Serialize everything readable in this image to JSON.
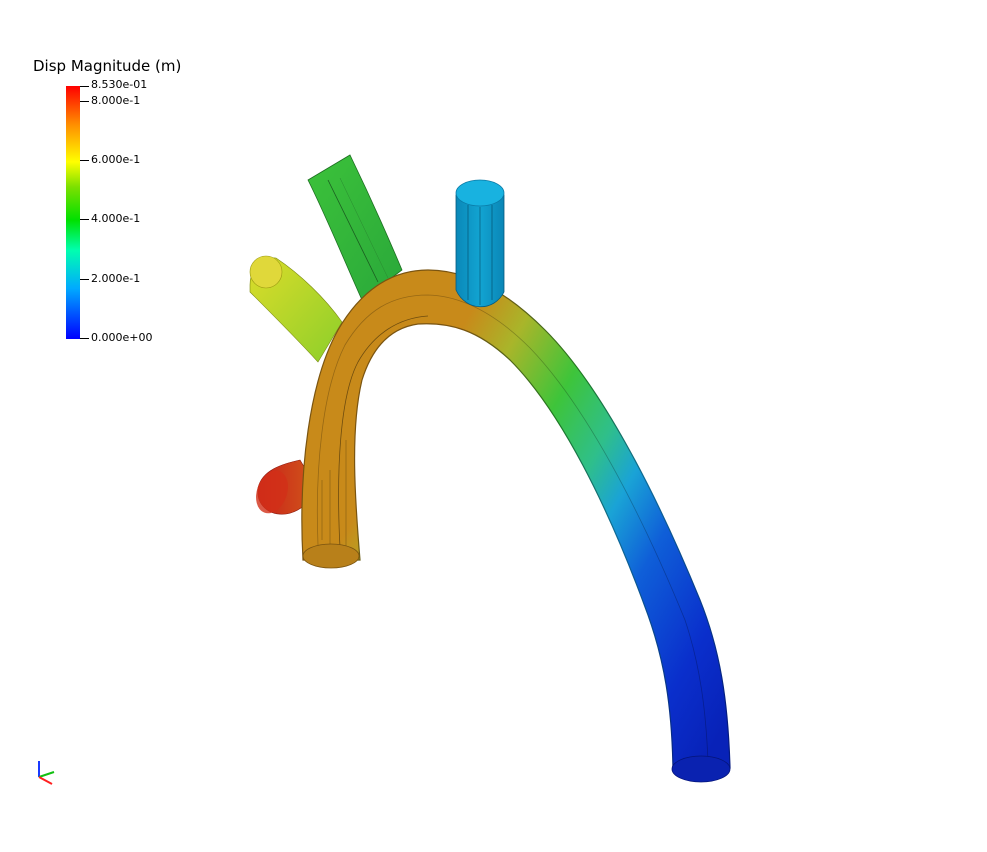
{
  "legend": {
    "title": "Disp Magnitude (m)",
    "ticks": [
      {
        "label": "8.530e-01",
        "value": 0.853
      },
      {
        "label": "8.000e-1",
        "value": 0.8
      },
      {
        "label": "6.000e-1",
        "value": 0.6
      },
      {
        "label": "4.000e-1",
        "value": 0.4
      },
      {
        "label": "2.000e-1",
        "value": 0.2
      },
      {
        "label": "0.000e+00",
        "value": 0.0
      }
    ],
    "range": [
      0.0,
      0.853
    ],
    "colormap": [
      "#0000ff",
      "#00aaff",
      "#00ffb0",
      "#00e000",
      "#ffff00",
      "#ff8c00",
      "#ff0000"
    ]
  },
  "scene": {
    "object": "aortic-arch-mesh",
    "background": "#ffffff"
  }
}
